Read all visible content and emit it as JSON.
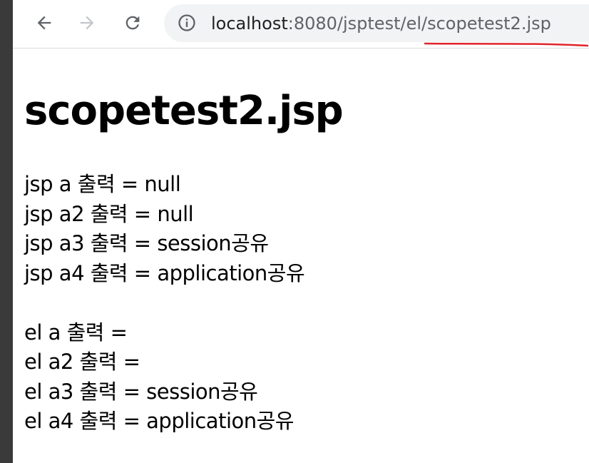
{
  "browser": {
    "url_host": "localhost",
    "url_path": ":8080/jsptest/el/scopetest2.jsp"
  },
  "page": {
    "title": "scopetest2.jsp",
    "jsp_lines": [
      "jsp a 출력 = null",
      "jsp a2 출력 = null",
      "jsp a3 출력 = session공유",
      "jsp a4 출력 = application공유"
    ],
    "el_lines": [
      "el a 출력 =",
      "el a2 출력 =",
      "el a3 출력 = session공유",
      "el a4 출력 = application공유"
    ]
  },
  "colors": {
    "annotation_underline": "#e0242a"
  }
}
